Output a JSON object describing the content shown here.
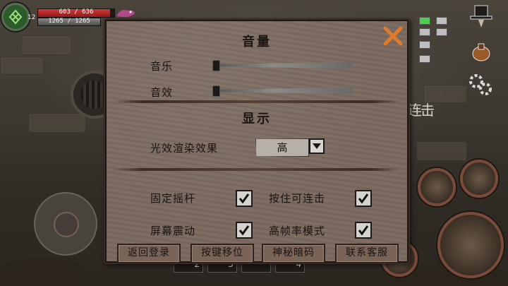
{
  "hud": {
    "level": "12",
    "hp_text": "603 / 636",
    "hp_fraction": 0.948,
    "mp_text": "1265 / 1265",
    "mp_fraction": 1.0,
    "combo_text": "连击"
  },
  "hotbar": {
    "slots": [
      "2",
      "3",
      "",
      "4"
    ]
  },
  "settings": {
    "volume_title": "音量",
    "music_label": "音乐",
    "music_level": 0.0,
    "sfx_label": "音效",
    "sfx_level": 0.0,
    "display_title": "显示",
    "lighting_label": "光效渲染效果",
    "lighting_value": "高",
    "fixed_joystick_label": "固定摇杆",
    "fixed_joystick_checked": true,
    "hold_combo_label": "按住可连击",
    "hold_combo_checked": true,
    "screen_shake_label": "屏幕震动",
    "screen_shake_checked": true,
    "high_fps_label": "高帧率模式",
    "high_fps_checked": true,
    "buttons": {
      "back_to_login": "返回登录",
      "move_keys": "按键移位",
      "secret_code": "神秘暗码",
      "contact_support": "联系客服"
    }
  },
  "colors": {
    "hp": "#d43a3a",
    "minimap_current": "#4dd04d",
    "close_x": "#e07a2c"
  },
  "icons": [
    "portrait-icon",
    "close-icon",
    "hat-icon",
    "bag-icon",
    "gear-icon",
    "dropdown-arrow-icon",
    "checkmark-icon"
  ]
}
